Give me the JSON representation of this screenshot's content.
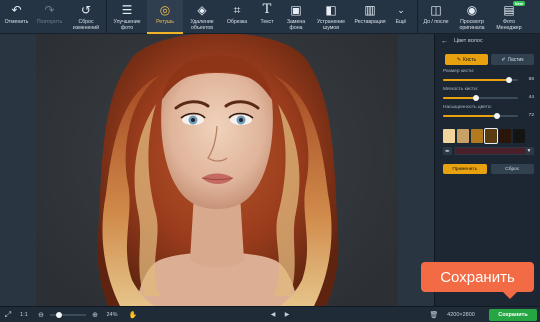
{
  "toolbar": {
    "items": [
      {
        "label": "Отменить",
        "icon": "undo-icon"
      },
      {
        "label": "Повторить",
        "icon": "redo-icon"
      },
      {
        "label": "Сброс изменений",
        "icon": "reset-icon"
      },
      {
        "label": "Улучшение фото",
        "icon": "sliders-icon"
      },
      {
        "label": "Ретушь",
        "icon": "retouch-icon"
      },
      {
        "label": "Удаление объектов",
        "icon": "eraser-icon"
      },
      {
        "label": "Обрезка",
        "icon": "crop-icon"
      },
      {
        "label": "Текст",
        "icon": "text-icon"
      },
      {
        "label": "Замена фона",
        "icon": "background-icon"
      },
      {
        "label": "Устранение шумов",
        "icon": "denoise-icon"
      },
      {
        "label": "Реставрация",
        "icon": "restore-icon"
      },
      {
        "label": "Ещё",
        "icon": "chevron-down-icon"
      },
      {
        "label": "До / после",
        "icon": "compare-icon"
      },
      {
        "label": "Просмотр оригинала",
        "icon": "eye-icon"
      },
      {
        "label": "Фото Менеджер",
        "icon": "photo-manager-icon",
        "badge": "New"
      }
    ]
  },
  "panel": {
    "title": "Цвет волос",
    "brush_tab": "Кисть",
    "eraser_tab": "Ластик",
    "sliders": [
      {
        "label": "Размер кисти:",
        "value": "88",
        "fraction": 0.88
      },
      {
        "label": "Мягкость кисти:",
        "value": "44",
        "fraction": 0.44
      },
      {
        "label": "Насыщенность цвета:",
        "value": "72",
        "fraction": 0.72
      }
    ],
    "swatches": [
      "#f1d49a",
      "#c9a066",
      "#b37a1e",
      "#5a3a12",
      "#2a1608",
      "#141414"
    ],
    "selected_swatch": 3,
    "current_color": "#4b1f2a",
    "apply_label": "Применить",
    "reset_label": "Сброс"
  },
  "save_tooltip": "Сохранить",
  "bottom": {
    "fit_label": "1:1",
    "zoom_value": "24%",
    "zoom_fraction": 0.24,
    "image_size": "4200×2800",
    "save_label": "Сохранить"
  },
  "colors": {
    "accent": "#e8a20f",
    "save_green": "#25a642",
    "tooltip": "#f26b45"
  }
}
